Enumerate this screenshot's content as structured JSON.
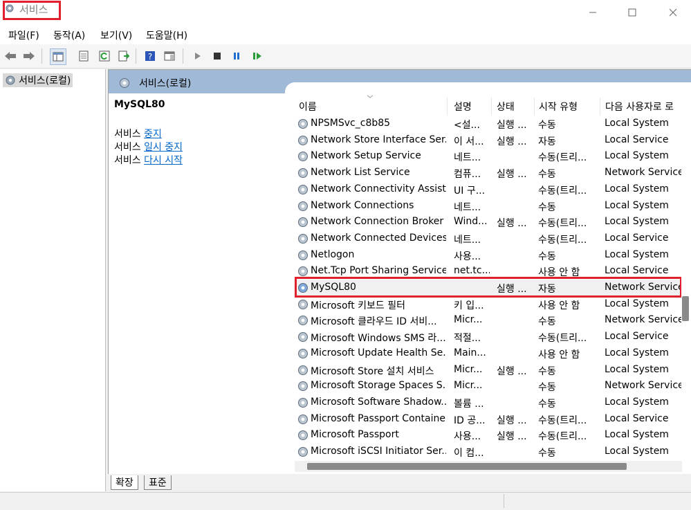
{
  "window": {
    "title": "서비스"
  },
  "menu": [
    "파일(F)",
    "동작(A)",
    "보기(V)",
    "도움말(H)"
  ],
  "tree": {
    "root_label": "서비스(로컬)"
  },
  "panel": {
    "header": "서비스(로컬)",
    "selected_service": "MySQL80",
    "actions": [
      {
        "prefix": "서비스",
        "link": "중지"
      },
      {
        "prefix": "서비스",
        "link": "일시 중지"
      },
      {
        "prefix": "서비스",
        "link": "다시 시작"
      }
    ]
  },
  "table": {
    "columns": [
      "이름",
      "설명",
      "상태",
      "시작 유형",
      "다음 사용자로 로"
    ],
    "rows": [
      {
        "name": "NPSMSvc_c8b85",
        "desc": "<설...",
        "status": "실행 ...",
        "start": "수동",
        "logon": "Local System"
      },
      {
        "name": "Network Store Interface Ser...",
        "desc": "이 서...",
        "status": "실행 ...",
        "start": "자동",
        "logon": "Local Service"
      },
      {
        "name": "Network Setup Service",
        "desc": "네트...",
        "status": "",
        "start": "수동(트리...",
        "logon": "Local System"
      },
      {
        "name": "Network List Service",
        "desc": "컴퓨...",
        "status": "실행 ...",
        "start": "수동",
        "logon": "Network Service"
      },
      {
        "name": "Network Connectivity Assist...",
        "desc": "UI 구...",
        "status": "",
        "start": "수동(트리...",
        "logon": "Local System"
      },
      {
        "name": "Network Connections",
        "desc": "네트...",
        "status": "",
        "start": "수동",
        "logon": "Local System"
      },
      {
        "name": "Network Connection Broker",
        "desc": "Wind...",
        "status": "실행 ...",
        "start": "수동(트리...",
        "logon": "Local System"
      },
      {
        "name": "Network Connected Devices...",
        "desc": "네트...",
        "status": "",
        "start": "수동(트리...",
        "logon": "Local Service"
      },
      {
        "name": "Netlogon",
        "desc": "사용...",
        "status": "",
        "start": "수동",
        "logon": "Local System"
      },
      {
        "name": "Net.Tcp Port Sharing Service",
        "desc": "net.tc...",
        "status": "",
        "start": "사용 안 함",
        "logon": "Local Service"
      },
      {
        "name": "MySQL80",
        "desc": "",
        "status": "실행 ...",
        "start": "자동",
        "logon": "Network Service",
        "selected": true
      },
      {
        "name": "Microsoft 키보드 필터",
        "desc": "키 입...",
        "status": "",
        "start": "사용 안 함",
        "logon": "Local System"
      },
      {
        "name": "Microsoft 클라우드 ID 서비...",
        "desc": "Micr...",
        "status": "",
        "start": "수동",
        "logon": "Network Service"
      },
      {
        "name": "Microsoft Windows SMS 라...",
        "desc": "적절...",
        "status": "",
        "start": "수동(트리...",
        "logon": "Local Service"
      },
      {
        "name": "Microsoft Update Health Se...",
        "desc": "Main...",
        "status": "",
        "start": "사용 안 함",
        "logon": "Local System"
      },
      {
        "name": "Microsoft Store 설치 서비스",
        "desc": "Micr...",
        "status": "실행 ...",
        "start": "수동",
        "logon": "Local System"
      },
      {
        "name": "Microsoft Storage Spaces S...",
        "desc": "Micr...",
        "status": "",
        "start": "수동",
        "logon": "Network Service"
      },
      {
        "name": "Microsoft Software Shadow...",
        "desc": "볼륨 ...",
        "status": "",
        "start": "수동",
        "logon": "Local System"
      },
      {
        "name": "Microsoft Passport Container",
        "desc": "ID 공...",
        "status": "실행 ...",
        "start": "수동(트리...",
        "logon": "Local Service"
      },
      {
        "name": "Microsoft Passport",
        "desc": "사용...",
        "status": "실행 ...",
        "start": "수동(트리...",
        "logon": "Local System"
      },
      {
        "name": "Microsoft iSCSI Initiator Ser...",
        "desc": "이 컴...",
        "status": "",
        "start": "수동",
        "logon": "Local System"
      }
    ]
  },
  "tabs": [
    "확장",
    "표준"
  ],
  "colors": {
    "highlight_border": "#e0202a",
    "header_band": "#9fb9d6",
    "link": "#0066cc"
  }
}
